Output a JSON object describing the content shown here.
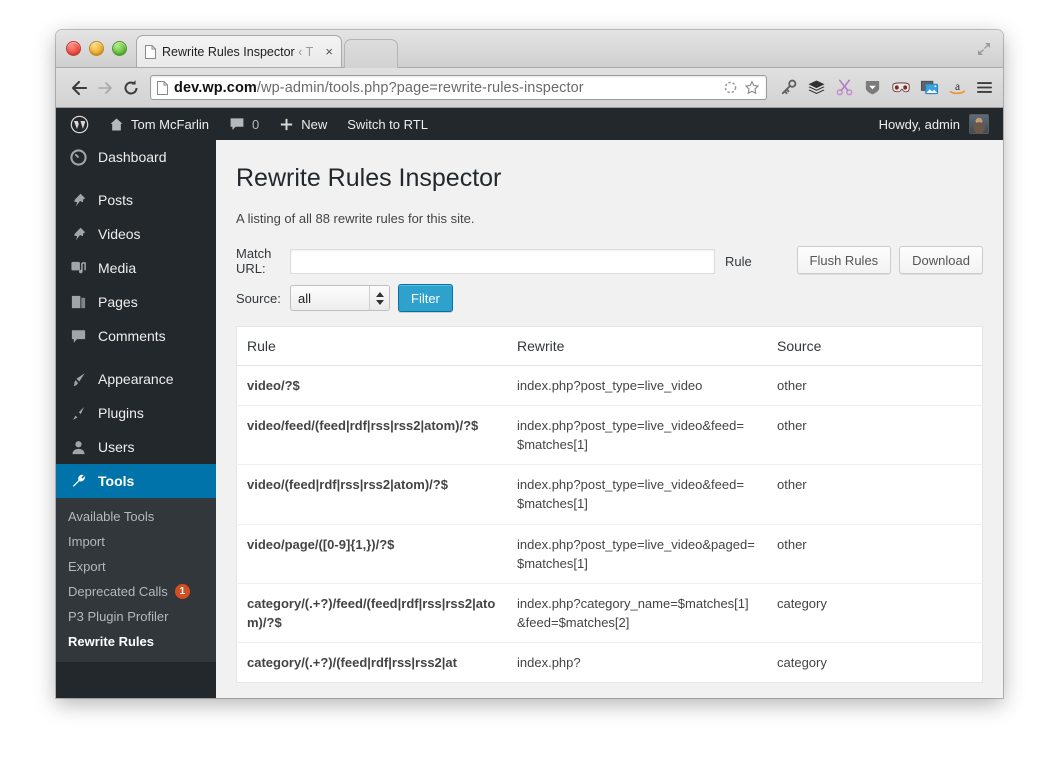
{
  "browser": {
    "tab": {
      "title": "Rewrite Rules Inspector",
      "suffix": "‹ T",
      "close": "×"
    },
    "nav": {
      "back": "←",
      "forward": "→",
      "reload": "⟳"
    },
    "url": {
      "host": "dev.wp.com",
      "path": "/wp-admin/tools.php?page=rewrite-rules-inspector"
    },
    "extensions": [
      "key-icon",
      "layers-icon",
      "scissors-icon",
      "shield-icon",
      "mask-icon",
      "screenshot-icon",
      "amazon-icon",
      "menu-icon"
    ]
  },
  "adminbar": {
    "logo": "wordpress-icon",
    "site_name": "Tom McFarlin",
    "comments_count": "0",
    "new_label": "New",
    "rtl_label": "Switch to RTL",
    "howdy": "Howdy, admin"
  },
  "sidebar": {
    "items": [
      {
        "label": "Dashboard",
        "icon": "dashboard-icon",
        "current": false
      },
      {
        "label": "Posts",
        "icon": "pin-icon",
        "current": false
      },
      {
        "label": "Videos",
        "icon": "pin-icon",
        "current": false
      },
      {
        "label": "Media",
        "icon": "media-icon",
        "current": false
      },
      {
        "label": "Pages",
        "icon": "pages-icon",
        "current": false
      },
      {
        "label": "Comments",
        "icon": "comment-icon",
        "current": false
      },
      {
        "label": "Appearance",
        "icon": "brush-icon",
        "current": false
      },
      {
        "label": "Plugins",
        "icon": "plug-icon",
        "current": false
      },
      {
        "label": "Users",
        "icon": "user-icon",
        "current": false
      },
      {
        "label": "Tools",
        "icon": "wrench-icon",
        "current": true
      }
    ],
    "submenu": [
      {
        "label": "Available Tools",
        "current": false,
        "badge": null
      },
      {
        "label": "Import",
        "current": false,
        "badge": null
      },
      {
        "label": "Export",
        "current": false,
        "badge": null
      },
      {
        "label": "Deprecated Calls",
        "current": false,
        "badge": "1"
      },
      {
        "label": "P3 Plugin Profiler",
        "current": false,
        "badge": null
      },
      {
        "label": "Rewrite Rules",
        "current": true,
        "badge": null
      }
    ]
  },
  "page": {
    "title": "Rewrite Rules Inspector",
    "description": "A listing of all 88 rewrite rules for this site.",
    "match_url_label": "Match URL:",
    "match_url_value": "",
    "match_url_placeholder": "",
    "rule_label": "Rule",
    "source_label": "Source:",
    "source_value": "all",
    "source_options": [
      "all"
    ],
    "filter_button": "Filter",
    "flush_button": "Flush Rules",
    "download_button": "Download"
  },
  "table": {
    "columns": [
      "Rule",
      "Rewrite",
      "Source"
    ],
    "rows": [
      {
        "rule": "video/?$",
        "rewrite": "index.php?post_type=live_video",
        "source": "other"
      },
      {
        "rule": "video/feed/(feed|rdf|rss|rss2|atom)/?$",
        "rewrite": "index.php?post_type=live_video&feed=$matches[1]",
        "source": "other"
      },
      {
        "rule": "video/(feed|rdf|rss|rss2|atom)/?$",
        "rewrite": "index.php?post_type=live_video&feed=$matches[1]",
        "source": "other"
      },
      {
        "rule": "video/page/([0-9]{1,})/?$",
        "rewrite": "index.php?post_type=live_video&paged=$matches[1]",
        "source": "other"
      },
      {
        "rule": "category/(.+?)/feed/(feed|rdf|rss|rss2|atom)/?$",
        "rewrite": "index.php?category_name=$matches[1]&feed=$matches[2]",
        "source": "category"
      },
      {
        "rule": "category/(.+?)/(feed|rdf|rss|rss2|at",
        "rewrite": "index.php?",
        "source": "category"
      }
    ]
  },
  "colors": {
    "wp_admin_dark": "#23282d",
    "wp_submenu": "#32373c",
    "wp_blue": "#0073aa",
    "filter_blue": "#2ea2cc",
    "badge_orange": "#d54e21",
    "page_bg": "#f1f1f1"
  }
}
